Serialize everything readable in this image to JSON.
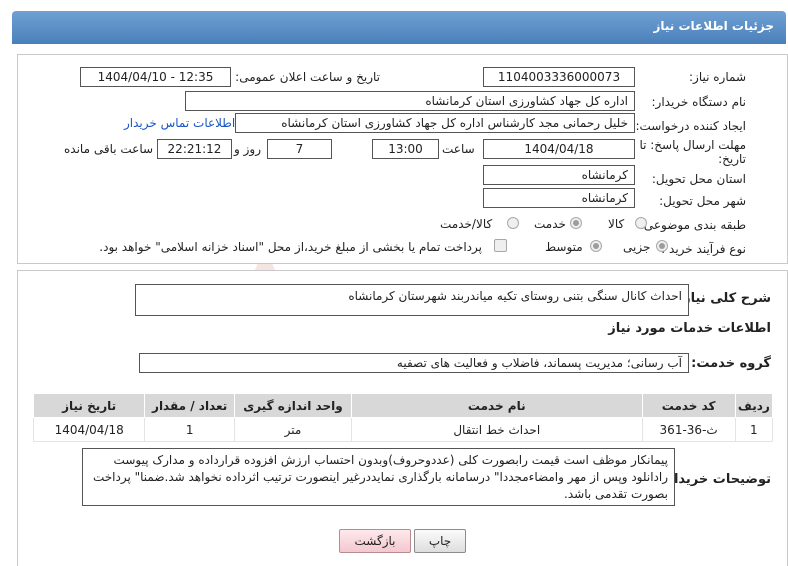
{
  "header": {
    "title": "جزئیات اطلاعات نیاز"
  },
  "form": {
    "need_number_label": "شماره نیاز:",
    "need_number": "1104003336000073",
    "announce_label": "تاریخ و ساعت اعلان عمومی:",
    "announce_value": "1404/04/10 - 12:35",
    "buyer_org_label": "نام دستگاه خریدار:",
    "buyer_org": "اداره کل جهاد کشاورزی استان کرمانشاه",
    "creator_label": "ایجاد کننده درخواست:",
    "creator": "خلیل رحمانی مجد کارشناس اداره کل جهاد کشاورزی استان کرمانشاه",
    "contact_link": "اطلاعات تماس خریدار",
    "deadline_label_1": "مهلت ارسال پاسخ: تا",
    "deadline_label_2": "تاریخ:",
    "deadline_date": "1404/04/18",
    "hour_label": "ساعت",
    "deadline_time": "13:00",
    "days_value": "7",
    "days_label": "روز و",
    "remaining_time": "22:21:12",
    "remaining_label": "ساعت باقی مانده",
    "province_label": "استان محل تحویل:",
    "province": "کرمانشاه",
    "city_label": "شهر محل تحویل:",
    "city": "کرمانشاه",
    "category_label": "طبقه بندی موضوعی:",
    "category_options": [
      "کالا",
      "خدمت",
      "کالا/خدمت"
    ],
    "category_selected": "خدمت",
    "process_label": "نوع فرآیند خرید :",
    "process_options": [
      "جزیی",
      "متوسط"
    ],
    "process_selected": "جزیی",
    "payment_text": "پرداخت تمام یا بخشی از مبلغ خرید،از محل \"اسناد خزانه اسلامی\" خواهد بود."
  },
  "summary": {
    "label": "شرح کلی نیاز:",
    "text": "احداث کانال سنگی بتنی روستای تکیه میاندربند شهرستان کرمانشاه"
  },
  "services": {
    "section_title": "اطلاعات خدمات مورد نیاز",
    "group_label": "گروه خدمت:",
    "group_value": "آب رسانی؛ مدیریت پسماند، فاضلاب و فعالیت های تصفیه",
    "columns": [
      "ردیف",
      "کد خدمت",
      "نام خدمت",
      "واحد اندازه گیری",
      "تعداد / مقدار",
      "تاریخ نیاز"
    ],
    "rows": [
      [
        "1",
        "ث-36-361",
        "احداث خط انتقال",
        "متر",
        "1",
        "1404/04/18"
      ]
    ]
  },
  "notes": {
    "label": "توضیحات خریدار:",
    "text": "پیمانکار موظف است قیمت رابصورت کلی (عددوحروف)وبدون احتساب ارزش افزوده قرارداده و مدارک پیوست رادانلود وپس از مهر وامضاءمجددا\" درسامانه بارگذاری نمایددرغیر اینصورت ترتیب اثرداده نخواهد شد.ضمنا\" پرداخت بصورت تقدمی باشد."
  },
  "buttons": {
    "print": "چاپ",
    "back": "بازگشت"
  },
  "watermark": {
    "text": "AriaTender.neT"
  }
}
